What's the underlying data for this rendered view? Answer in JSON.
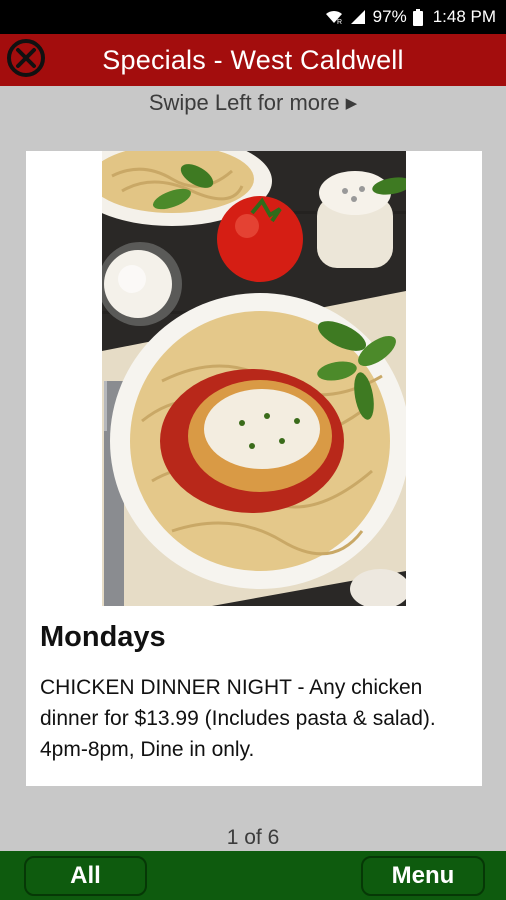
{
  "status_bar": {
    "battery": "97%",
    "time": "1:48 PM"
  },
  "header": {
    "title": "Specials - West Caldwell"
  },
  "swipe_hint": {
    "text": "Swipe Left for more",
    "arrow": "▶"
  },
  "special": {
    "day": "Mondays",
    "description": "CHICKEN DINNER NIGHT - Any chicken dinner for $13.99 (Includes pasta & salad). 4pm-8pm, Dine in only."
  },
  "pager": {
    "text": "1 of 6"
  },
  "footer": {
    "all_label": "All",
    "menu_label": "Menu"
  },
  "colors": {
    "title_bar": "#a30d0d",
    "footer_bar": "#0e5b0e",
    "background": "#c8c8c8"
  }
}
